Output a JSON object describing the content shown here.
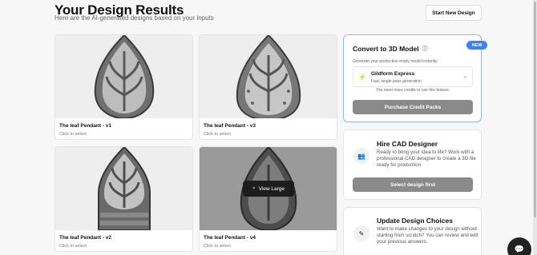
{
  "header": {
    "title": "Your Design Results",
    "subtitle": "Here are the AI-generated designs based on your inputs",
    "start_button": "Start New Design"
  },
  "designs": [
    {
      "name": "The leaf Pendant - v1",
      "hint": "Click to select"
    },
    {
      "name": "The leaf Pendant - v3",
      "hint": "Click to select"
    },
    {
      "name": "The leaf Pendant - v2",
      "hint": "Click to select"
    },
    {
      "name": "The leaf Pendant - v4",
      "hint": "Click to select",
      "overlay": "View Large"
    }
  ],
  "convert": {
    "badge": "NEW",
    "title": "Convert to 3D Model",
    "subtitle": "Generate your production-ready model instantly",
    "engine_name": "Gildform Express",
    "engine_desc": "Fast, single-pass generation",
    "note": "You need more credits to use this feature",
    "button": "Purchase Credit Packs"
  },
  "cad": {
    "title": "Hire CAD Designer",
    "text": "Ready to bring your idea to life? Work with a professional CAD designer to create a 3D file ready for production",
    "button": "Select design first"
  },
  "update": {
    "title": "Update Design Choices",
    "text": "Want to make changes to your design without starting from scratch? You can review and edit your previous answers."
  }
}
